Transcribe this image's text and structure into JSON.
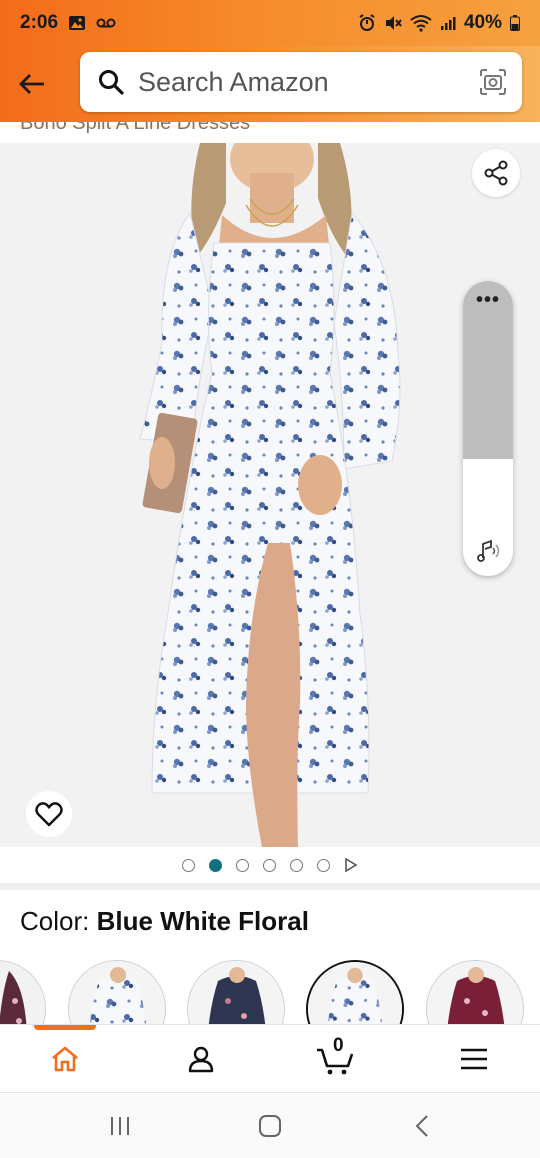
{
  "status_bar": {
    "time": "2:06",
    "battery": "40%"
  },
  "header": {
    "search_placeholder": "Search Amazon"
  },
  "product": {
    "title_partial": "Boho Split A Line Dresses",
    "image_count": 6,
    "active_image": 1
  },
  "variation": {
    "label": "Color: ",
    "value": "Blue White Floral"
  },
  "swatches": [
    {
      "name": "floral-dark"
    },
    {
      "name": "blue-white-floral-alt"
    },
    {
      "name": "navy-floral"
    },
    {
      "name": "blue-white-floral"
    },
    {
      "name": "burgundy-floral"
    }
  ],
  "bottom_nav": [
    "home",
    "account",
    "cart",
    "menu"
  ],
  "cart_count": "0",
  "colors": {
    "accent": "#f46c1c",
    "dot_active": "#137083"
  }
}
